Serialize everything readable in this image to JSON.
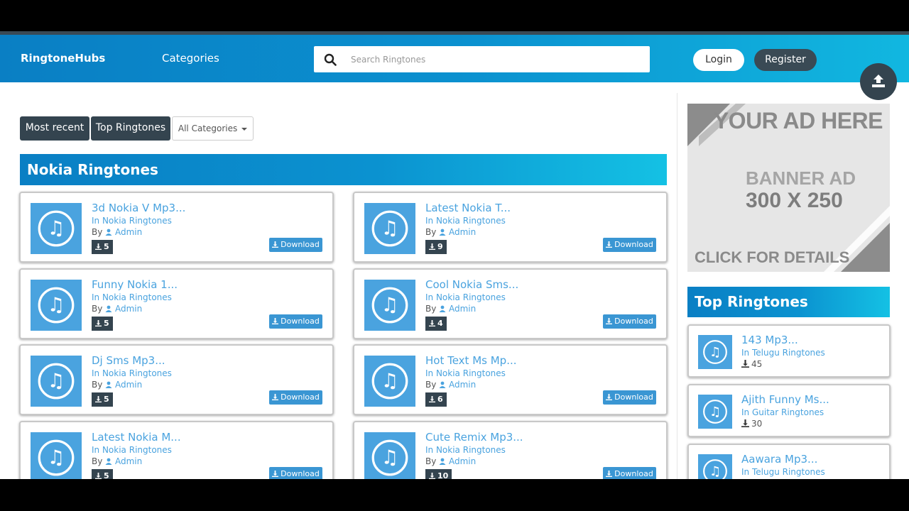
{
  "header": {
    "brand": "RingtoneHubs",
    "categories_label": "Categories",
    "search_placeholder": "Search Ringtones",
    "login_label": "Login",
    "register_label": "Register"
  },
  "filters": {
    "most_recent": "Most recent",
    "top_ringtones": "Top Ringtones",
    "all_categories": "All Categories"
  },
  "section_title": "Nokia Ringtones",
  "by_label": "By",
  "download_label": "Download",
  "ringtones": [
    {
      "title": "3d Nokia V Mp3...",
      "category": "In Nokia Ringtones",
      "author": "Admin",
      "downloads": "5"
    },
    {
      "title": "Latest Nokia T...",
      "category": "In Nokia Ringtones",
      "author": "Admin",
      "downloads": "9"
    },
    {
      "title": "Funny Nokia 1...",
      "category": "In Nokia Ringtones",
      "author": "Admin",
      "downloads": "5"
    },
    {
      "title": "Cool Nokia Sms...",
      "category": "In Nokia Ringtones",
      "author": "Admin",
      "downloads": "4"
    },
    {
      "title": "Dj Sms Mp3...",
      "category": "In Nokia Ringtones",
      "author": "Admin",
      "downloads": "5"
    },
    {
      "title": "Hot Text Ms Mp...",
      "category": "In Nokia Ringtones",
      "author": "Admin",
      "downloads": "6"
    },
    {
      "title": "Latest Nokia M...",
      "category": "In Nokia Ringtones",
      "author": "Admin",
      "downloads": "5"
    },
    {
      "title": "Cute Remix Mp3...",
      "category": "In Nokia Ringtones",
      "author": "Admin",
      "downloads": "10"
    }
  ],
  "ad": {
    "line1": "YOUR AD HERE",
    "line2": "BANNER AD",
    "line3": "300 X 250",
    "line4": "CLICK FOR DETAILS"
  },
  "sidebar": {
    "title": "Top Ringtones",
    "items": [
      {
        "title": "143 Mp3...",
        "category": "In Telugu Ringtones",
        "downloads": "45"
      },
      {
        "title": "Ajith Funny Ms...",
        "category": "In Guitar Ringtones",
        "downloads": "30"
      },
      {
        "title": "Aawara Mp3...",
        "category": "In Telugu Ringtones",
        "downloads": ""
      }
    ]
  },
  "colors": {
    "header_gradient_start": "#0a7fc4",
    "header_gradient_end": "#11b7e0",
    "dark": "#34444f",
    "accent": "#4aa3df"
  }
}
